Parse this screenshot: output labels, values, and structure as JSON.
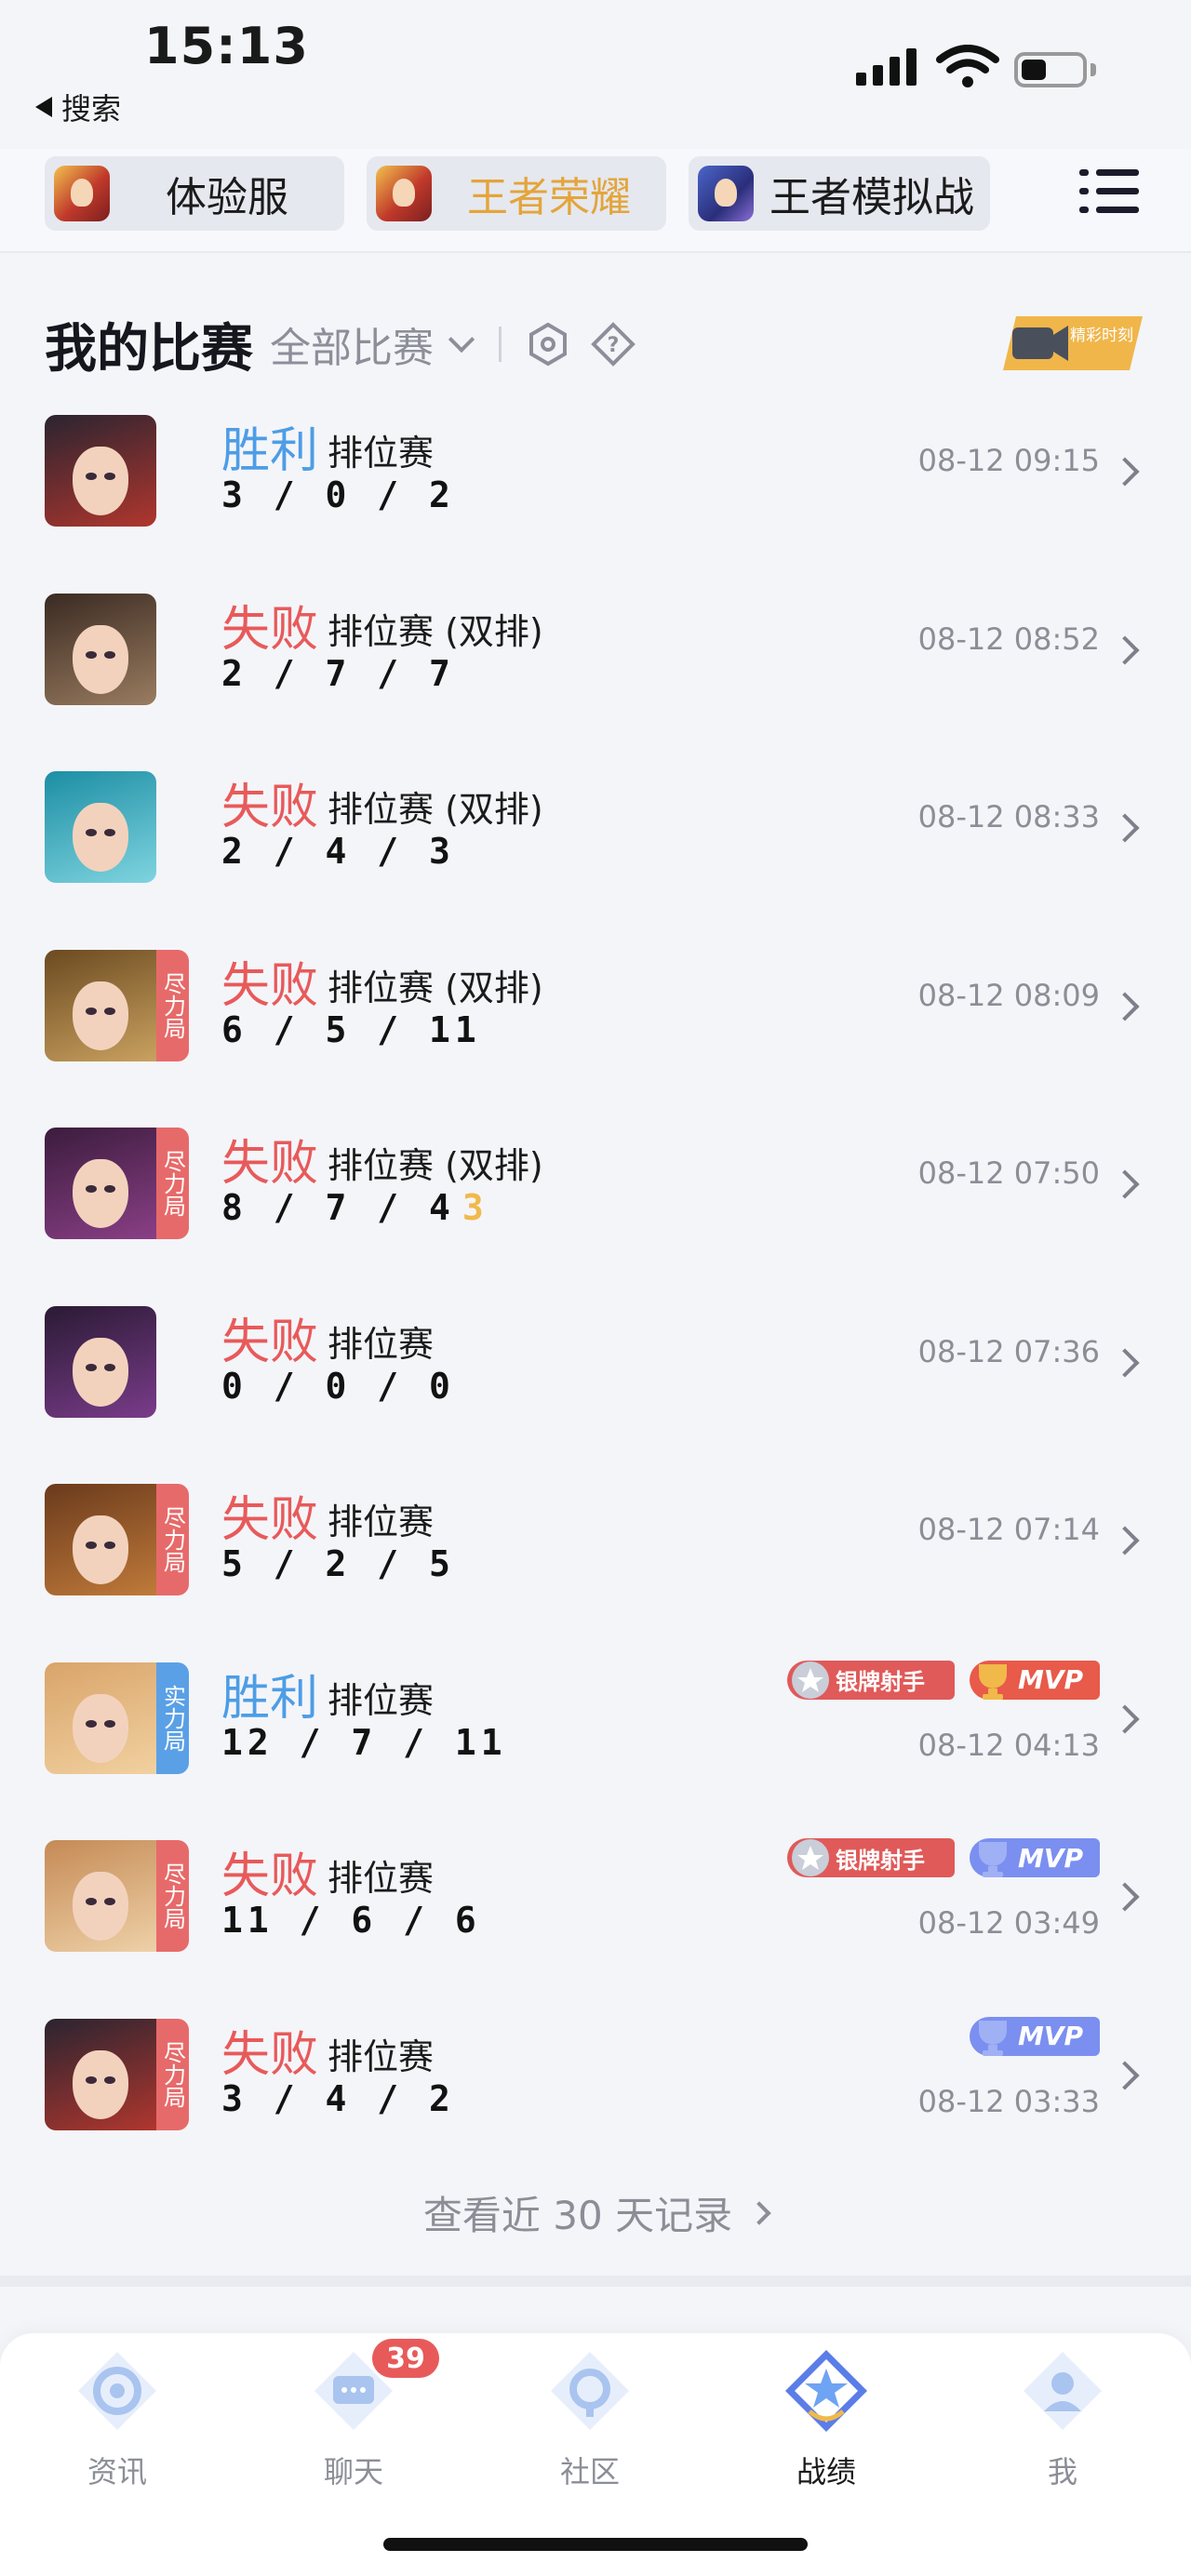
{
  "status_bar": {
    "time": "15:13",
    "back_label": "搜索"
  },
  "game_tabs": [
    {
      "label": "体验服",
      "active": false
    },
    {
      "label": "王者荣耀",
      "active": true
    },
    {
      "label": "王者模拟战",
      "active": false
    }
  ],
  "section": {
    "title": "我的比赛",
    "filter": "全部比赛"
  },
  "highlight_badge": "精彩时刻",
  "matches": [
    {
      "result": "胜利",
      "mode": "排位赛",
      "kda": "3 / 0 / 2",
      "kda_extra": "",
      "time": "08-12 09:15",
      "tag": "",
      "badges": []
    },
    {
      "result": "失败",
      "mode": "排位赛 (双排)",
      "kda": "2 / 7 / 7",
      "kda_extra": "",
      "time": "08-12 08:52",
      "tag": "",
      "badges": []
    },
    {
      "result": "失败",
      "mode": "排位赛 (双排)",
      "kda": "2 / 4 / 3",
      "kda_extra": "",
      "time": "08-12 08:33",
      "tag": "",
      "badges": []
    },
    {
      "result": "失败",
      "mode": "排位赛 (双排)",
      "kda": "6 / 5 / 11",
      "kda_extra": "",
      "time": "08-12 08:09",
      "tag": "尽力局",
      "badges": []
    },
    {
      "result": "失败",
      "mode": "排位赛 (双排)",
      "kda": "8 / 7 / 4",
      "kda_extra": "3",
      "time": "08-12 07:50",
      "tag": "尽力局",
      "badges": []
    },
    {
      "result": "失败",
      "mode": "排位赛",
      "kda": "0 / 0 / 0",
      "kda_extra": "",
      "time": "08-12 07:36",
      "tag": "",
      "badges": []
    },
    {
      "result": "失败",
      "mode": "排位赛",
      "kda": "5 / 2 / 5",
      "kda_extra": "",
      "time": "08-12 07:14",
      "tag": "尽力局",
      "badges": []
    },
    {
      "result": "胜利",
      "mode": "排位赛",
      "kda": "12 / 7 / 11",
      "kda_extra": "",
      "time": "08-12 04:13",
      "tag": "实力局",
      "badges": [
        "银牌射手",
        "MVP"
      ]
    },
    {
      "result": "失败",
      "mode": "排位赛",
      "kda": "11 / 6 / 6",
      "kda_extra": "",
      "time": "08-12 03:49",
      "tag": "尽力局",
      "badges": [
        "银牌射手",
        "MVP"
      ]
    },
    {
      "result": "失败",
      "mode": "排位赛",
      "kda": "3 / 4 / 2",
      "kda_extra": "",
      "time": "08-12 03:33",
      "tag": "尽力局",
      "badges": [
        "MVP"
      ]
    }
  ],
  "view_more": "查看近 30 天记录",
  "bottom_nav": [
    {
      "label": "资讯",
      "icon": "news-icon"
    },
    {
      "label": "聊天",
      "icon": "chat-icon",
      "badge": "39"
    },
    {
      "label": "社区",
      "icon": "community-icon"
    },
    {
      "label": "战绩",
      "icon": "record-icon",
      "active": true
    },
    {
      "label": "我",
      "icon": "profile-icon"
    }
  ],
  "colors": {
    "win": "#4d9de6",
    "lose": "#e85a5a",
    "accent_gold": "#e3a53b",
    "tag_red": "#e76a6a",
    "tag_blue": "#5aa0e6"
  }
}
